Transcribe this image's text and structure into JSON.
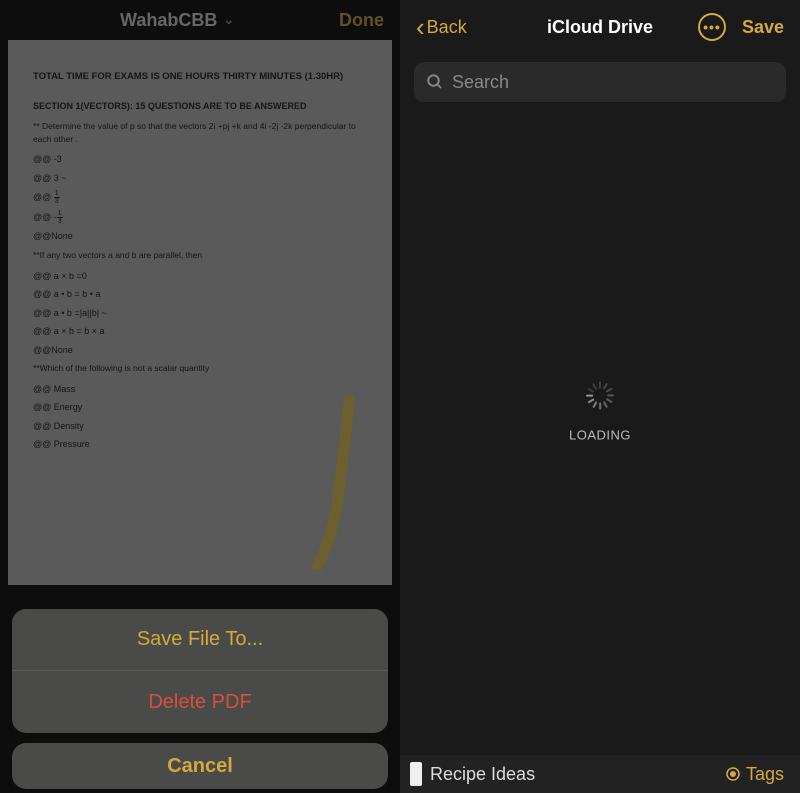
{
  "left": {
    "header": {
      "title": "WahabCBB",
      "done": "Done"
    },
    "document": {
      "total_time": "TOTAL TIME FOR EXAMS IS ONE HOURS THIRTY MINUTES (1.30HR)",
      "section": "SECTION 1(VECTORS): 15 QUESTIONS ARE TO BE ANSWERED",
      "q1_prompt": "** Determine the value of  p so that the vectors 2i  +pj  +k and 4i -2j -2k perpendicular to each other .",
      "opt_neg3": "@@  -3",
      "opt_3": "@@ 3       ~",
      "opt_1_3": "@@",
      "frac_1_3_num": "1",
      "frac_1_3_den": "3",
      "opt_neg1_3": "@@",
      "neg_sign": "-",
      "opt_none1": "@@None",
      "q2_prompt": "**If any two vectors  a  and  b  are parallel, then",
      "opt_axb0": "@@  a  × b  =0",
      "opt_adotb": "@@  a • b   = b • a",
      "opt_amod": "@@  a  • b   =|a||b|     ~",
      "opt_axbba": "@@  a  × b  = b  × a",
      "opt_none2": "@@None",
      "q3_prompt": "**Which of the following is not a scalar quantity",
      "opt_mass": "@@ Mass",
      "opt_energy": "@@ Energy",
      "opt_density": "@@ Density",
      "opt_pressure": "@@ Pressure"
    },
    "sheet": {
      "save_to": "Save File To...",
      "delete": "Delete PDF",
      "cancel": "Cancel"
    }
  },
  "right": {
    "header": {
      "back": "Back",
      "title": "iCloud Drive",
      "save": "Save"
    },
    "search": {
      "placeholder": "Search"
    },
    "loading": "LOADING",
    "bottom": {
      "folder": "Recipe Ideas",
      "tags": "Tags"
    }
  }
}
